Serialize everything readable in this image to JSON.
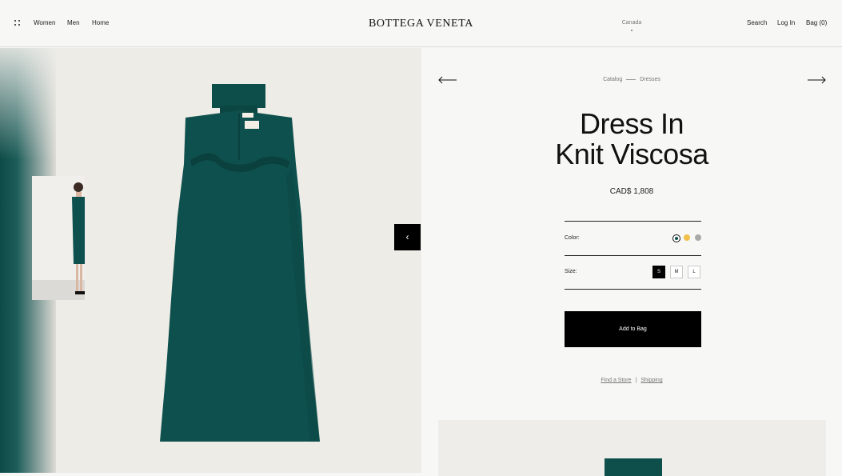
{
  "header": {
    "nav": [
      "Women",
      "Men",
      "Home"
    ],
    "logo": "BOTTEGA VENETA",
    "region": "Canada",
    "actions": {
      "search": "Search",
      "login": "Log In",
      "bag": "Bag (0)"
    }
  },
  "breadcrumb": {
    "catalog": "Catalog",
    "current": "Dresses"
  },
  "product": {
    "title_line1": "Dress In",
    "title_line2": "Knit Viscosa",
    "price": "CAD$ 1,808",
    "color_label": "Color:",
    "colors": [
      "#0e4f4c",
      "#f1c04b",
      "#a9a9a9"
    ],
    "size_label": "Size:",
    "sizes": [
      "S",
      "M",
      "L"
    ],
    "selected_size": "S",
    "add_to_bag": "Add to Bag",
    "links": {
      "store": "Find a Store",
      "separator": "|",
      "shipping": "Shipping"
    }
  },
  "gallery": {
    "prev_glyph": "‹",
    "next_glyph": "›"
  },
  "icons": [
    "menu-grid-icon",
    "arrow-left-icon",
    "arrow-right-icon",
    "chevron-left-icon",
    "chevron-right-icon"
  ]
}
